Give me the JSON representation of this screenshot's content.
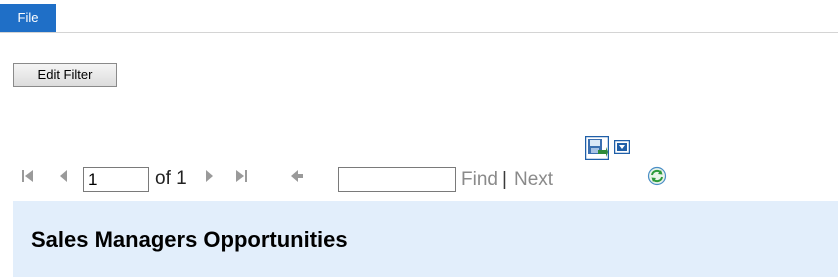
{
  "ribbon": {
    "file_tab_label": "File"
  },
  "filter": {
    "edit_filter_label": "Edit Filter"
  },
  "pager": {
    "current_page": "1",
    "total_label": "of 1"
  },
  "find": {
    "value": "",
    "find_label": "Find",
    "separator": "|",
    "next_label": "Next"
  },
  "report": {
    "title": "Sales Managers Opportunities"
  },
  "icons": {
    "first_page": "first-page-icon",
    "previous_page": "previous-page-icon",
    "next_page": "next-page-icon",
    "last_page": "last-page-icon",
    "back": "back-to-parent-icon",
    "export": "export-icon",
    "export_dropdown": "export-dropdown-icon",
    "refresh": "refresh-icon"
  },
  "colors": {
    "file_tab": "#1f6fc7",
    "report_header_bg": "#e2eefb",
    "disabled_text": "#8a8a8a"
  }
}
